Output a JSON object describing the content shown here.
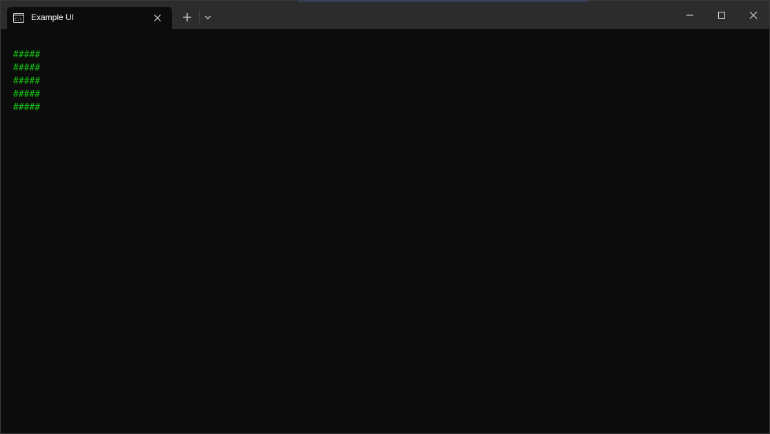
{
  "window": {
    "tab_title": "Example UI",
    "tab_icon": "terminal-icon"
  },
  "titlebar_buttons": {
    "new_tab_icon": "plus-icon",
    "dropdown_icon": "chevron-down-icon",
    "minimize_icon": "minimize-icon",
    "maximize_icon": "maximize-icon",
    "close_icon": "close-icon"
  },
  "colors": {
    "terminal_background": "#0c0c0c",
    "titlebar_background": "#2c2c2c",
    "text_green": "#13c413"
  },
  "terminal": {
    "lines": [
      "#####",
      "#####",
      "#####",
      "#####",
      "#####"
    ]
  }
}
